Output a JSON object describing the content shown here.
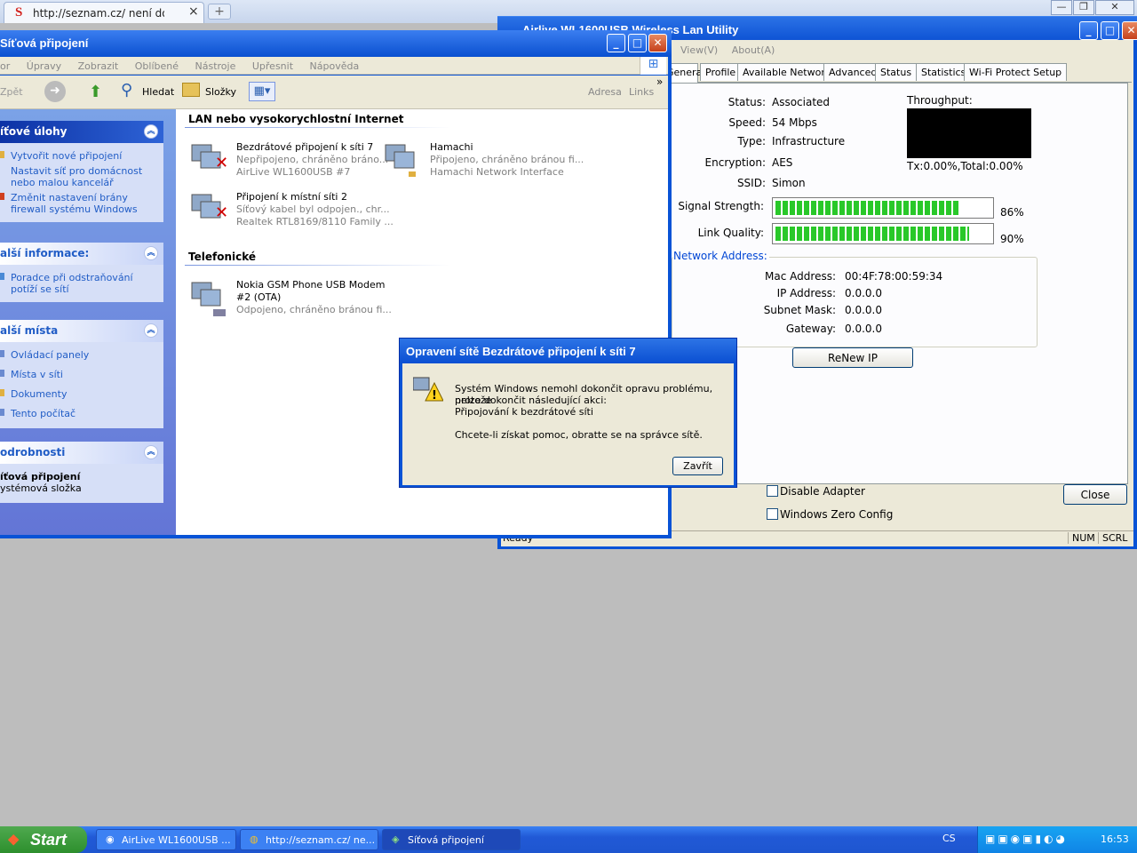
{
  "chrome": {
    "tab_title": "http://seznam.cz/ není dostup",
    "logo": "S",
    "new_tab": "+",
    "close": "×"
  },
  "airlive": {
    "title": "Airlive WL1600USB Wireless Lan Utility",
    "menu": [
      "View(V)",
      "About(A)"
    ],
    "tabs": [
      "General",
      "Profile",
      "Available Network",
      "Advanced",
      "Status",
      "Statistics",
      "Wi-Fi Protect Setup"
    ],
    "labels": {
      "status": "Status:",
      "speed": "Speed:",
      "type": "Type:",
      "encryption": "Encryption:",
      "ssid": "SSID:",
      "signal": "Signal Strength:",
      "link": "Link Quality:",
      "throughput": "Throughput:"
    },
    "values": {
      "status": "Associated",
      "speed": "54 Mbps",
      "type": "Infrastructure",
      "encryption": "AES",
      "ssid": "Simon"
    },
    "signal_strength": 86,
    "signal_text": "86%",
    "link_quality": 90,
    "link_text": "90%",
    "throughput_text": "Tx:0.00%,Total:0.00%",
    "network_address": {
      "legend": "Network Address:",
      "mac_label": "Mac Address:",
      "mac": "00:4F:78:00:59:34",
      "ip_label": "IP Address:",
      "ip": "0.0.0.0",
      "mask_label": "Subnet Mask:",
      "mask": "0.0.0.0",
      "gw_label": "Gateway:",
      "gw": "0.0.0.0"
    },
    "renew_button": "ReNew IP",
    "disable_adapter": "Disable Adapter",
    "zero_config": "Windows Zero Config",
    "close_button": "Close",
    "status_bar": {
      "left": "Ready",
      "num": "NUM",
      "scrl": "SCRL"
    }
  },
  "explorer": {
    "title": "Síťová připojení",
    "menu": [
      "or",
      "Úpravy",
      "Zobrazit",
      "Oblíbené",
      "Nástroje",
      "Upřesnit",
      "Nápověda"
    ],
    "toolbar": {
      "back": "Zpět",
      "search": "Hledat",
      "folders": "Složky",
      "address": "Adresa",
      "links": "Links",
      "more": "»"
    },
    "tasks": {
      "title": "íťové úlohy",
      "items": [
        "Vytvořit nové připojení",
        "Nastavit síť pro domácnost nebo malou kancelář",
        "Změnit nastavení brány firewall systému Windows"
      ]
    },
    "info": {
      "title": "alší informace:",
      "items": [
        "Poradce při odstraňování potíží se sítí"
      ]
    },
    "places": {
      "title": "alší místa",
      "items": [
        "Ovládací panely",
        "Místa v síti",
        "Dokumenty",
        "Tento počítač"
      ]
    },
    "details": {
      "title": "odrobnosti",
      "name": "íťová připojení",
      "desc": "ystémová složka"
    },
    "section_lan": "LAN nebo vysokorychlostní Internet",
    "section_phone": "Telefonické",
    "connections": [
      {
        "name": "Bezdrátové připojení k síti 7",
        "status": "Nepřipojeno, chráněno bráno...",
        "device": "AirLive WL1600USB #7"
      },
      {
        "name": "Hamachi",
        "status": "Připojeno, chráněno bránou fi...",
        "device": "Hamachi Network Interface"
      },
      {
        "name": "Připojení k místní síti 2",
        "status": "Síťový kabel byl odpojen., chr...",
        "device": "Realtek RTL8169/8110 Family ..."
      },
      {
        "name": "Nokia GSM Phone USB Modem",
        "name2": "#2 (OTA)",
        "status": "Odpojeno, chráněno bránou fi..."
      }
    ]
  },
  "dialog": {
    "title": "Opravení sítě Bezdrátové připojení k síti 7",
    "line1": "Systém Windows nemohl dokončit opravu problému, protože",
    "line2": "nelze dokončit následující akci:",
    "line3": "Připojování k bezdrátové síti",
    "line4": "Chcete-li získat pomoc, obratte se na správce sítě.",
    "button": "Zavřít"
  },
  "taskbar": {
    "start": "Start",
    "tasks": [
      "AirLive WL1600USB ...",
      "http://seznam.cz/ ne...",
      "Síťová připojení"
    ],
    "lang": "CS",
    "clock": "16:53"
  }
}
